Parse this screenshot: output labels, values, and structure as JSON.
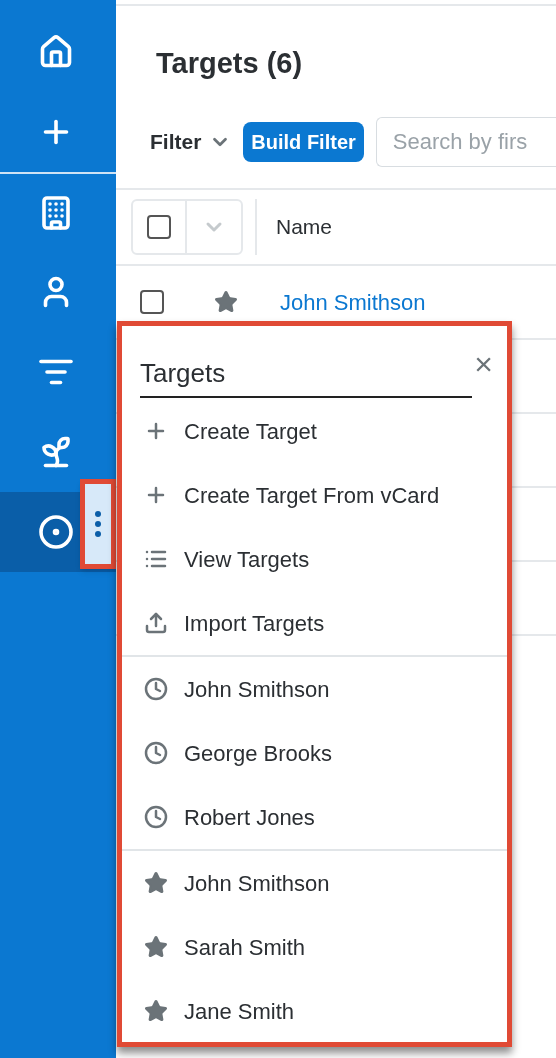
{
  "sidebar": {
    "items": [
      {
        "kind": "home",
        "selected": false
      },
      {
        "kind": "create",
        "selected": false
      },
      {
        "kind": "accounts",
        "selected": false
      },
      {
        "kind": "contacts",
        "selected": false
      },
      {
        "kind": "filter",
        "selected": false
      },
      {
        "kind": "leads",
        "selected": false
      },
      {
        "kind": "targets",
        "selected": true
      }
    ]
  },
  "header": {
    "title": "Targets (6)"
  },
  "filter_bar": {
    "filter_label": "Filter",
    "build_filter": "Build Filter",
    "search": {
      "placeholder": "Search by firs"
    }
  },
  "table": {
    "columns": [
      "Name"
    ],
    "select_all_checked": false,
    "rows": [
      {
        "name": "John Smithson",
        "checked": false,
        "favorite": true
      }
    ]
  },
  "menu": {
    "title": "Targets",
    "close": "×",
    "actions": [
      {
        "kind": "create",
        "label": "Create Target"
      },
      {
        "kind": "create",
        "label": "Create Target From vCard"
      },
      {
        "kind": "list",
        "label": "View Targets"
      },
      {
        "kind": "import",
        "label": "Import Targets"
      }
    ],
    "recent": [
      "John Smithson",
      "George Brooks",
      "Robert Jones"
    ],
    "favorites": [
      "John Smithson",
      "Sarah Smith",
      "Jane Smith"
    ]
  }
}
